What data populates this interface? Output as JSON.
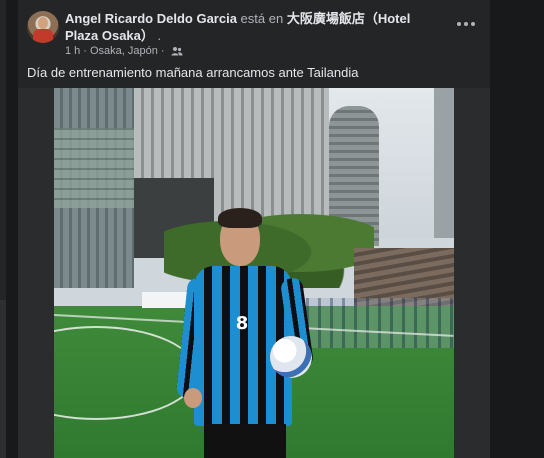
{
  "post": {
    "author": "Angel Ricardo Deldo Garcia",
    "verb": " está en ",
    "place": "大阪廣場飯店（Hotel Plaza Osaka）",
    "trailing": " .",
    "time": "1 h",
    "separator": "·",
    "location": "Osaka, Japón",
    "audience_icon": "friends-icon",
    "caption": "Día de entrenamiento mañana arrancamos ante Tailandia",
    "more_icon": "more-horizontal-icon"
  },
  "photo": {
    "jersey_number": "8"
  }
}
